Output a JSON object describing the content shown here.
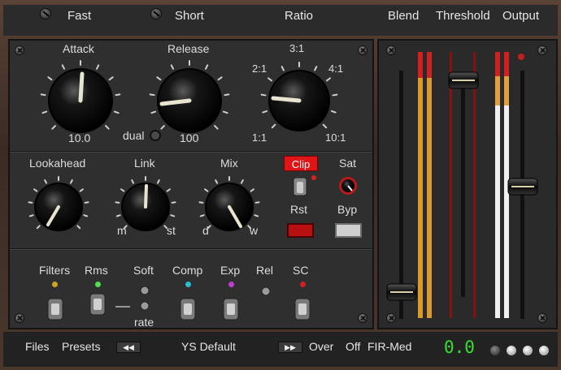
{
  "topbar": {
    "fast": "Fast",
    "short": "Short",
    "ratio": "Ratio",
    "blend": "Blend",
    "threshold": "Threshold",
    "output": "Output"
  },
  "dynamics": {
    "attack_label": "Attack",
    "attack_value": "10.0",
    "release_label": "Release",
    "release_value": "100",
    "dual_label": "dual",
    "ratio_marks": {
      "r3_1": "3:1",
      "r2_1": "2:1",
      "r4_1": "4:1",
      "r1_1": "1:1",
      "r10_1": "10:1"
    }
  },
  "middle": {
    "lookahead_label": "Lookahead",
    "link_label": "Link",
    "link_min": "m",
    "link_max": "st",
    "mix_label": "Mix",
    "mix_min": "d",
    "mix_max": "w",
    "clip_label": "Clip",
    "sat_label": "Sat",
    "rst_label": "Rst",
    "byp_label": "Byp"
  },
  "switches": {
    "filters": "Filters",
    "rms": "Rms",
    "soft": "Soft",
    "rate": "rate",
    "comp": "Comp",
    "exp": "Exp",
    "rel": "Rel",
    "sc": "SC"
  },
  "bottombar": {
    "files": "Files",
    "presets": "Presets",
    "preset_name": "YS Default",
    "over": "Over",
    "off": "Off",
    "fir": "FIR-Med",
    "output_readout": "0.0"
  },
  "colors": {
    "clip_red": "#e01515",
    "readout_green": "#38e02e",
    "led_yellow": "#c9a81c",
    "led_green": "#4ee04e",
    "led_cyan": "#2bbcd0",
    "led_magenta": "#c03bd0",
    "led_red": "#d02020"
  }
}
